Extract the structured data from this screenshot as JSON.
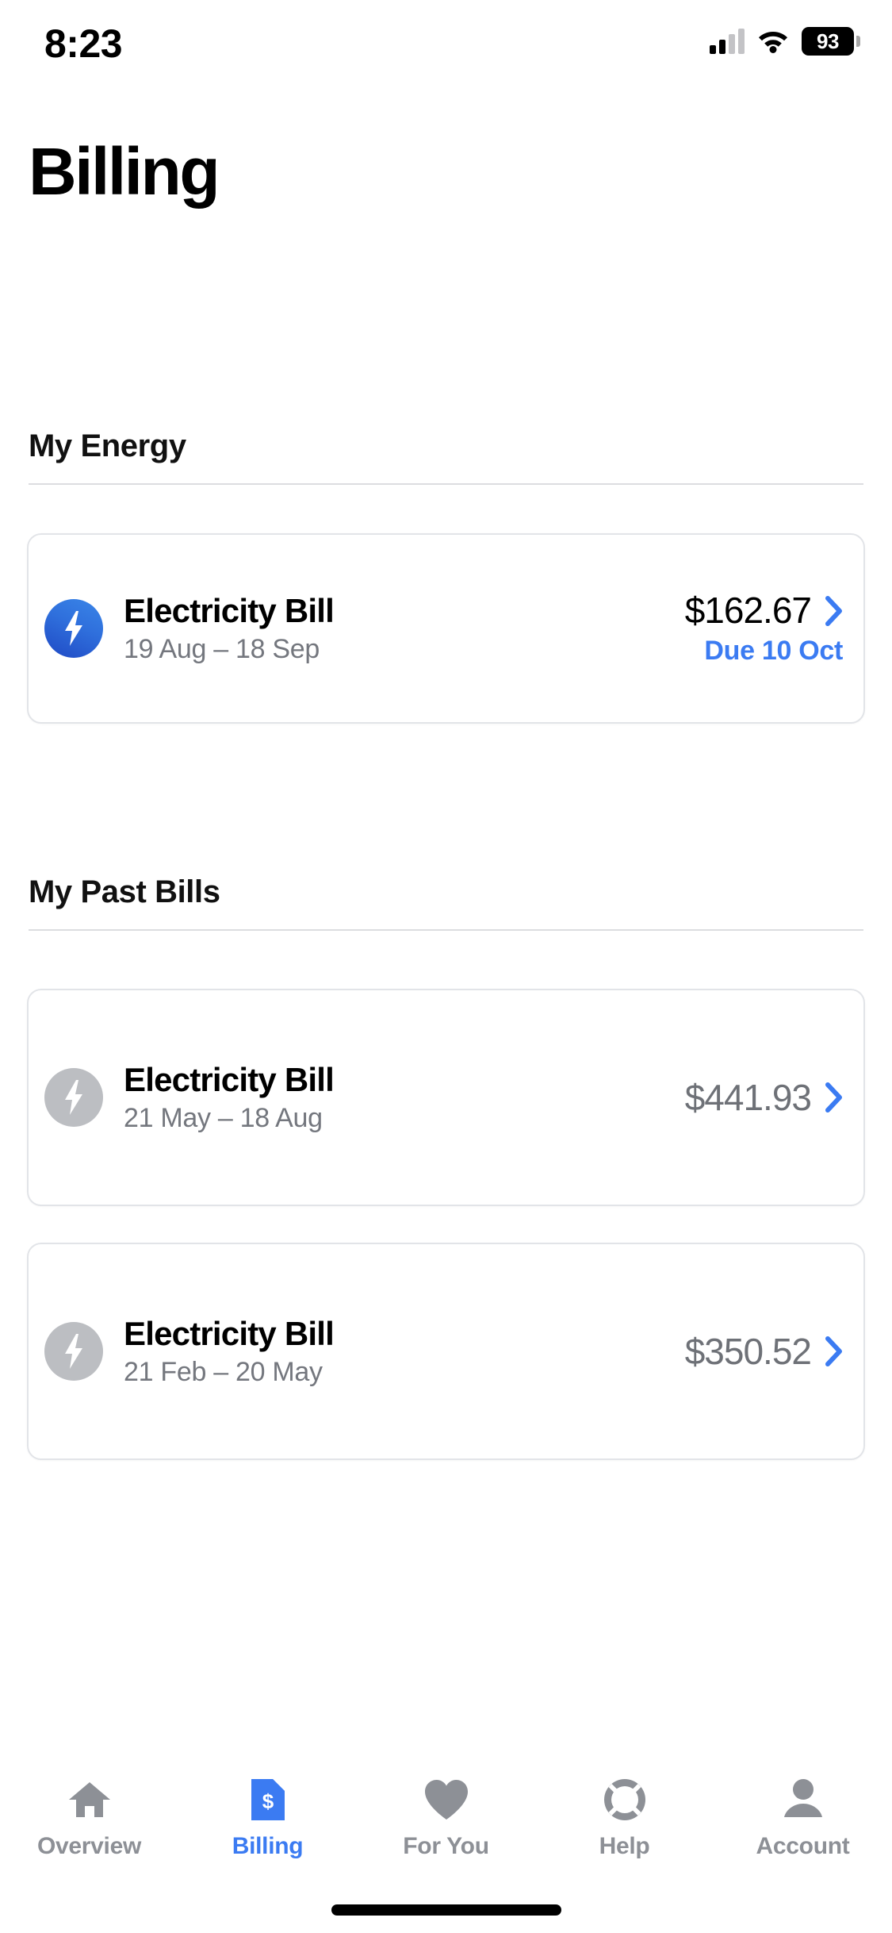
{
  "status_bar": {
    "time": "8:23",
    "battery_percent": "93",
    "signal_icon": "cellular-signal-icon",
    "wifi_icon": "wifi-icon",
    "battery_icon": "battery-icon"
  },
  "header": {
    "title": "Billing"
  },
  "sections": [
    {
      "heading": "My Energy",
      "bills": [
        {
          "icon": "lightning-bolt-icon",
          "title": "Electricity Bill",
          "period": "19 Aug – 18 Sep",
          "amount": "$162.67",
          "due": "Due 10 Oct",
          "chevron": "chevron-right-icon"
        }
      ]
    },
    {
      "heading": "My Past Bills",
      "bills": [
        {
          "icon": "lightning-bolt-icon",
          "title": "Electricity Bill",
          "period": "21 May – 18 Aug",
          "amount": "$441.93",
          "due": "",
          "chevron": "chevron-right-icon"
        },
        {
          "icon": "lightning-bolt-icon",
          "title": "Electricity Bill",
          "period": "21 Feb – 20 May",
          "amount": "$350.52",
          "due": "",
          "chevron": "chevron-right-icon"
        }
      ]
    }
  ],
  "tab_bar": {
    "active": "Billing",
    "items": [
      {
        "label": "Overview",
        "icon": "home-icon"
      },
      {
        "label": "Billing",
        "icon": "document-dollar-icon"
      },
      {
        "label": "For You",
        "icon": "heart-icon"
      },
      {
        "label": "Help",
        "icon": "lifebuoy-icon"
      },
      {
        "label": "Account",
        "icon": "person-icon"
      }
    ]
  },
  "colors": {
    "accent_blue": "#3b7bf2",
    "muted_grey": "#74777e",
    "amount_grey": "#6e7177",
    "icon_grey": "#bcbec2",
    "card_border": "#e2e4e8"
  }
}
